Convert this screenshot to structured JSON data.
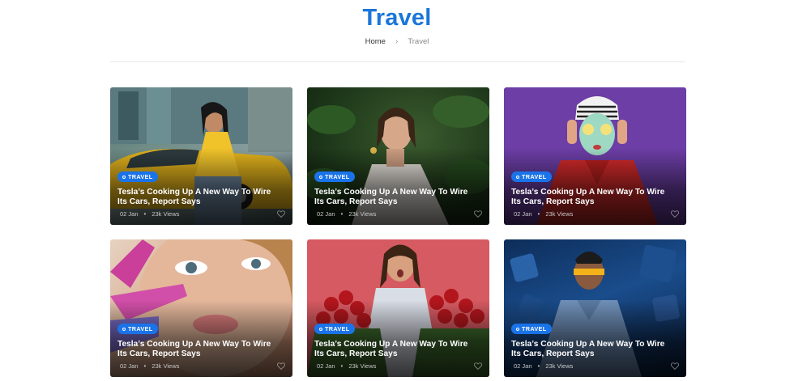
{
  "header": {
    "title": "Travel",
    "breadcrumb": {
      "home": "Home",
      "current": "Travel"
    }
  },
  "cards": [
    {
      "category": "TRAVEL",
      "title": "Tesla’s Cooking Up A New Way To Wire Its Cars, Report Says",
      "date": "02 Jan",
      "views": "23k Views"
    },
    {
      "category": "TRAVEL",
      "title": "Tesla’s Cooking Up A New Way To Wire Its Cars, Report Says",
      "date": "02 Jan",
      "views": "23k Views"
    },
    {
      "category": "TRAVEL",
      "title": "Tesla’s Cooking Up A New Way To Wire Its Cars, Report Says",
      "date": "02 Jan",
      "views": "23k Views"
    },
    {
      "category": "TRAVEL",
      "title": "Tesla’s Cooking Up A New Way To Wire Its Cars, Report Says",
      "date": "02 Jan",
      "views": "23k Views"
    },
    {
      "category": "TRAVEL",
      "title": "Tesla’s Cooking Up A New Way To Wire Its Cars, Report Says",
      "date": "02 Jan",
      "views": "23k Views"
    },
    {
      "category": "TRAVEL",
      "title": "Tesla’s Cooking Up A New Way To Wire Its Cars, Report Says",
      "date": "02 Jan",
      "views": "23k Views"
    }
  ],
  "colors": {
    "accent": "#1b76d9",
    "badge": "#1a73e8"
  },
  "icons": {
    "separator": "chevron-right-icon",
    "meta_separator": "dot-icon",
    "favorite": "heart-icon"
  }
}
